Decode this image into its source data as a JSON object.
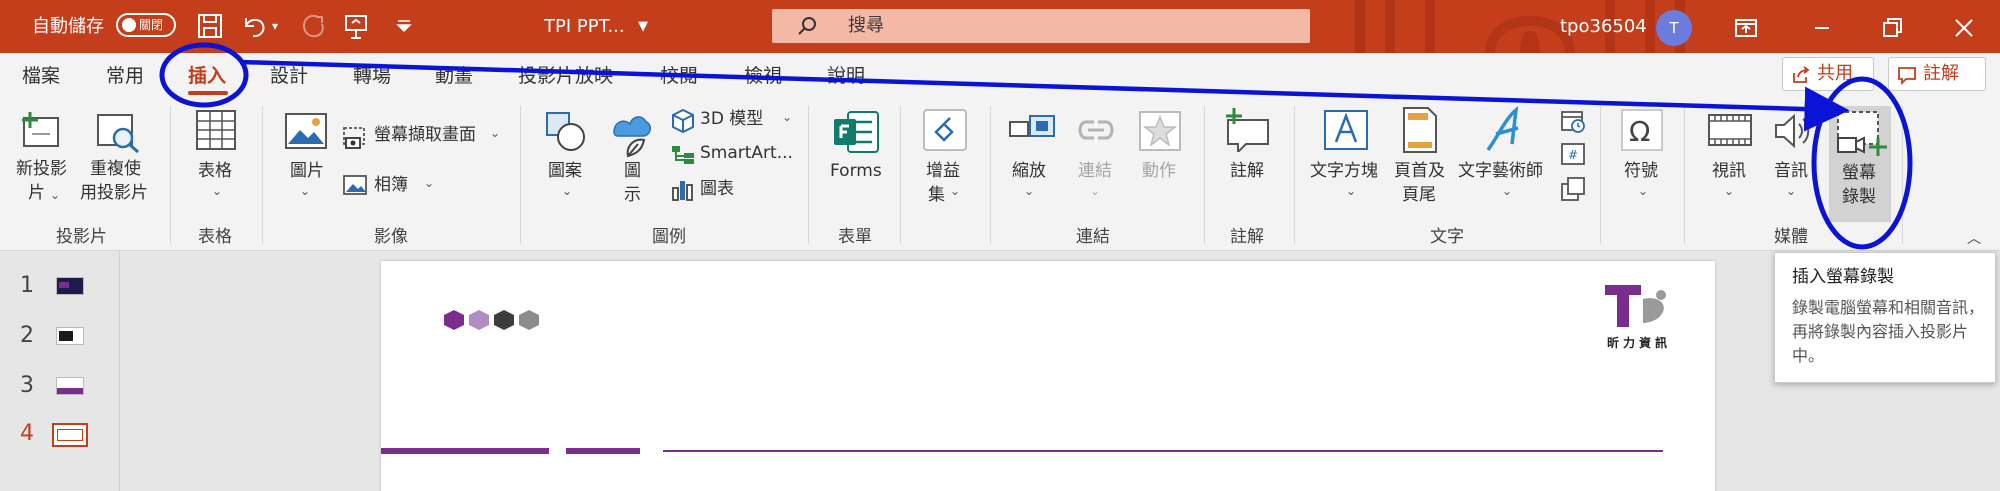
{
  "titlebar": {
    "autosave_label": "自動儲存",
    "autosave_state": "關閉",
    "file_name": "TPI PPT...",
    "search_placeholder": "搜尋",
    "user_name": "tpo36504",
    "user_initial": "T",
    "accent_color": "#c43e1c"
  },
  "tabs": [
    {
      "label": "檔案"
    },
    {
      "label": "常用"
    },
    {
      "label": "插入",
      "active": true
    },
    {
      "label": "設計"
    },
    {
      "label": "轉場"
    },
    {
      "label": "動畫"
    },
    {
      "label": "投影片放映"
    },
    {
      "label": "校閱"
    },
    {
      "label": "檢視"
    },
    {
      "label": "說明"
    }
  ],
  "actions": {
    "share_label": "共用",
    "comment_label": "註解"
  },
  "ribbon": {
    "slides": {
      "new_slide": [
        "新投影",
        "片"
      ],
      "reuse_slides": [
        "重複使",
        "用投影片"
      ],
      "group": "投影片"
    },
    "tables": {
      "table": "表格",
      "group": "表格"
    },
    "images": {
      "pictures": "圖片",
      "screenshot": "螢幕擷取畫面",
      "photo_album": "相簿",
      "group": "影像"
    },
    "illustrations": {
      "shapes": "圖案",
      "icons": [
        "圖",
        "示"
      ],
      "models_3d": "3D 模型",
      "smartart": "SmartArt...",
      "chart": "圖表",
      "group": "圖例"
    },
    "forms": {
      "forms": "Forms",
      "group": "表單"
    },
    "addins": {
      "addins": [
        "增益",
        "集"
      ]
    },
    "links": {
      "zoom": "縮放",
      "link": "連結",
      "action": "動作",
      "group": "連結"
    },
    "comments": {
      "comment": "註解",
      "group": "註解"
    },
    "text": {
      "textbox": "文字方塊",
      "header_footer": [
        "頁首及",
        "頁尾"
      ],
      "wordart": "文字藝術師",
      "group": "文字"
    },
    "symbols": {
      "symbol": "符號"
    },
    "media": {
      "video": "視訊",
      "audio": "音訊",
      "screen_recording": [
        "螢幕",
        "錄製"
      ],
      "group": "媒體"
    }
  },
  "slides_panel": {
    "numbers": [
      "1",
      "2",
      "3",
      "4"
    ],
    "current": "4"
  },
  "slide": {
    "logo_text": "昕力資訊",
    "hex_colors": [
      "#7b2d8e",
      "#b18cc4",
      "#3d3d3d",
      "#8c8c8c"
    ],
    "accent_bar_color": "#7b2d8e"
  },
  "tooltip": {
    "title": "插入螢幕錄製",
    "body": "錄製電腦螢幕和相關音訊，再將錄製內容插入投影片中。"
  },
  "annotation_color": "#0b14d6"
}
